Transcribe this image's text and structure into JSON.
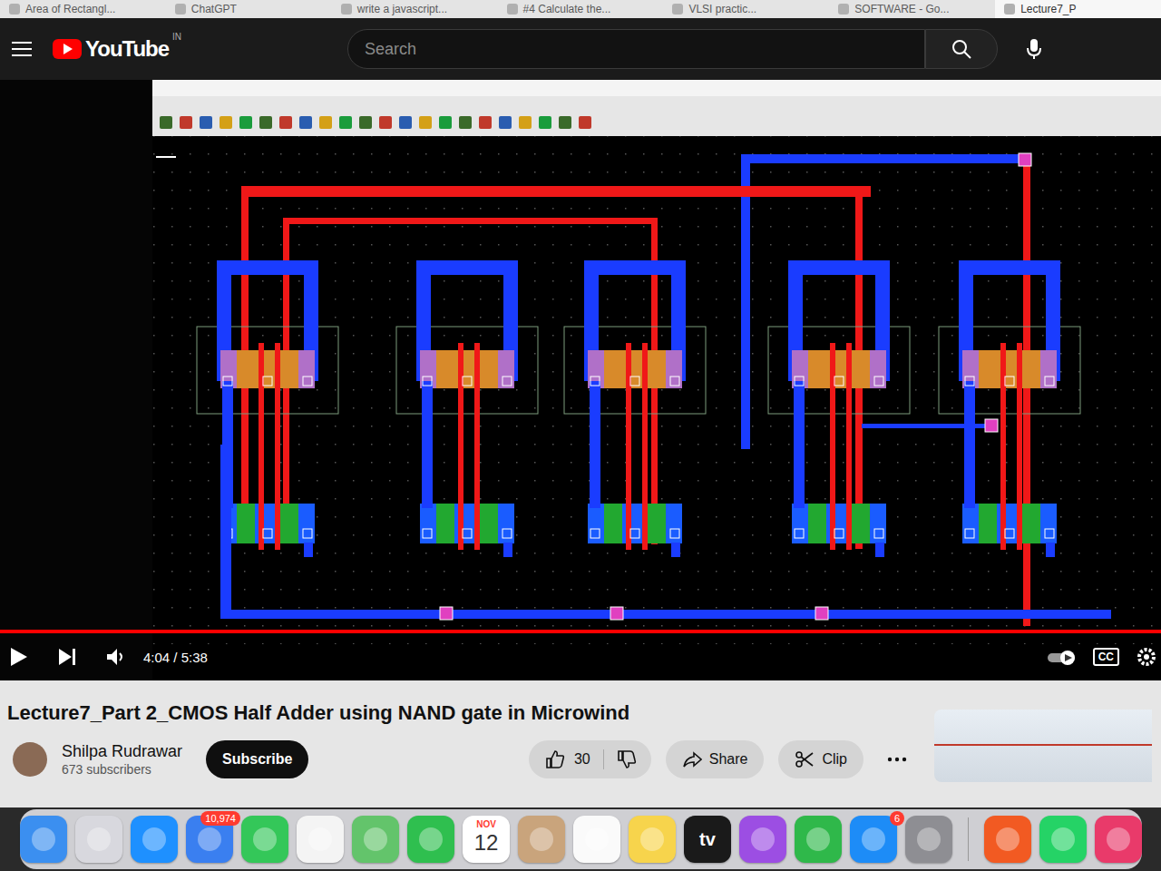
{
  "browser": {
    "tabs": [
      {
        "label": "Area of Rectangl...",
        "selected": false
      },
      {
        "label": "ChatGPT",
        "selected": false
      },
      {
        "label": "write a javascript...",
        "selected": false
      },
      {
        "label": "#4 Calculate the...",
        "selected": false
      },
      {
        "label": "VLSI practic...",
        "selected": false
      },
      {
        "label": "SOFTWARE - Go...",
        "selected": false
      },
      {
        "label": "Lecture7_P",
        "selected": true
      }
    ]
  },
  "header": {
    "logo": "YouTube",
    "region": "IN",
    "search": {
      "placeholder": "Search"
    }
  },
  "player": {
    "playing": false,
    "progress": 1,
    "time": "4:04 / 5:38",
    "captions": "CC"
  },
  "video": {
    "title": "Lecture7_Part 2_CMOS Half Adder using NAND gate in Microwind",
    "channel": "Shilpa Rudrawar",
    "subscribers": "673 subscribers",
    "subscribe": "Subscribe",
    "likes": "30",
    "actions": [
      {
        "label": "Share"
      },
      {
        "label": "Clip"
      }
    ]
  },
  "dock": {
    "items": [
      {
        "kind": "app",
        "color": "#3b8ff0"
      },
      {
        "kind": "app",
        "color": "#d8d8de"
      },
      {
        "kind": "app",
        "color": "#1e90ff"
      },
      {
        "kind": "app",
        "color": "#3a7ff0",
        "badge": "10,974"
      },
      {
        "kind": "app",
        "color": "#34c759"
      },
      {
        "kind": "app",
        "color": "#f4f4f4"
      },
      {
        "kind": "app",
        "color": "#63c46b"
      },
      {
        "kind": "app",
        "color": "#2fbf4f"
      },
      {
        "kind": "calendar",
        "color": "#ffffff",
        "month": "NOV",
        "day": "12"
      },
      {
        "kind": "app",
        "color": "#c9a47c"
      },
      {
        "kind": "app",
        "color": "#fafafa"
      },
      {
        "kind": "app",
        "color": "#f7d44c"
      },
      {
        "kind": "label",
        "color": "#1a1a1a",
        "text": "tv"
      },
      {
        "kind": "app",
        "color": "#9c4ee3"
      },
      {
        "kind": "app",
        "color": "#2fb84a"
      },
      {
        "kind": "app",
        "color": "#1d8cf7",
        "badge": "6"
      },
      {
        "kind": "app",
        "color": "#8e8e93"
      },
      {
        "kind": "separator"
      },
      {
        "kind": "app",
        "color": "#f25a22"
      },
      {
        "kind": "app",
        "color": "#25d366"
      },
      {
        "kind": "app",
        "color": "#e93a6a"
      }
    ]
  }
}
